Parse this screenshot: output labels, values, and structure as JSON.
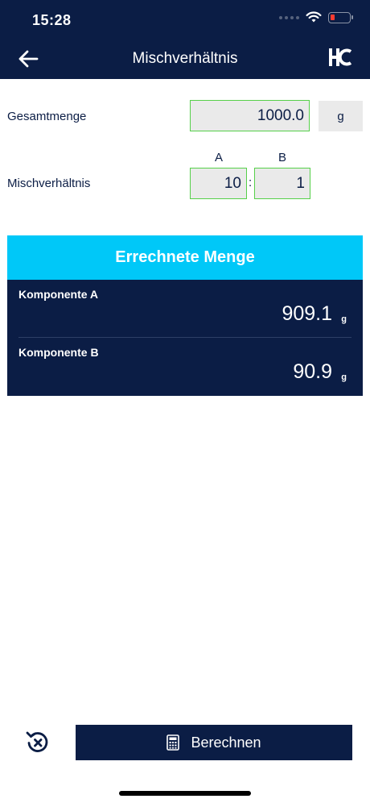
{
  "status_bar": {
    "time": "15:28"
  },
  "nav": {
    "title": "Mischverhältnis"
  },
  "form": {
    "total_label": "Gesamtmenge",
    "total_value": "1000.0",
    "unit": "g",
    "ratio_label": "Mischverhältnis",
    "col_a": "A",
    "col_b": "B",
    "ratio_a": "10",
    "ratio_separator": ":",
    "ratio_b": "1"
  },
  "results": {
    "header": "Errechnete Menge",
    "components": [
      {
        "label": "Komponente A",
        "value": "909.1",
        "unit": "g"
      },
      {
        "label": "Komponente B",
        "value": "90.9",
        "unit": "g"
      }
    ]
  },
  "actions": {
    "calculate_label": "Berechnen"
  },
  "colors": {
    "navy": "#0b1d45",
    "cyan": "#00c8f8",
    "field_border": "#56d04a",
    "field_bg": "#eaeaea"
  }
}
